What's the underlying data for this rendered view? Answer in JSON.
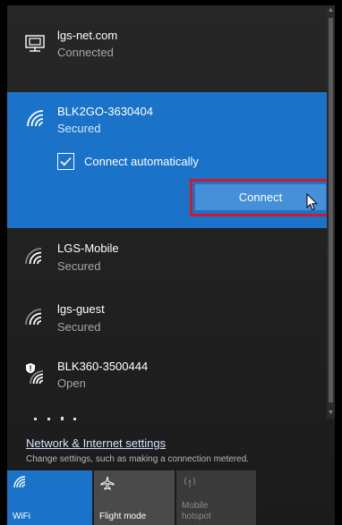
{
  "networks": {
    "wired": {
      "name": "lgs-net.com",
      "status": "Connected"
    },
    "selected": {
      "name": "BLK2GO-3630404",
      "status": "Secured",
      "connect_automatically_label": "Connect automatically",
      "connect_automatically_checked": true,
      "connect_button": "Connect"
    },
    "others": [
      {
        "name": "LGS-Mobile",
        "status": "Secured"
      },
      {
        "name": "lgs-guest",
        "status": "Secured"
      },
      {
        "name": "BLK360-3500444",
        "status": "Open"
      }
    ]
  },
  "settings": {
    "link": "Network & Internet settings",
    "description": "Change settings, such as making a connection metered."
  },
  "quick_actions": [
    {
      "label": "WiFi",
      "active": true,
      "icon": "wifi-icon"
    },
    {
      "label": "Flight mode",
      "active": false,
      "icon": "airplane-icon"
    },
    {
      "label": "Mobile hotspot",
      "line1": "Mobile",
      "line2": "hotspot",
      "disabled": true,
      "icon": "hotspot-icon"
    }
  ],
  "colors": {
    "accent": "#1a73c8",
    "connect_button": "#4590d8",
    "highlight_outline": "#d01a2b",
    "panel": "#222222"
  }
}
